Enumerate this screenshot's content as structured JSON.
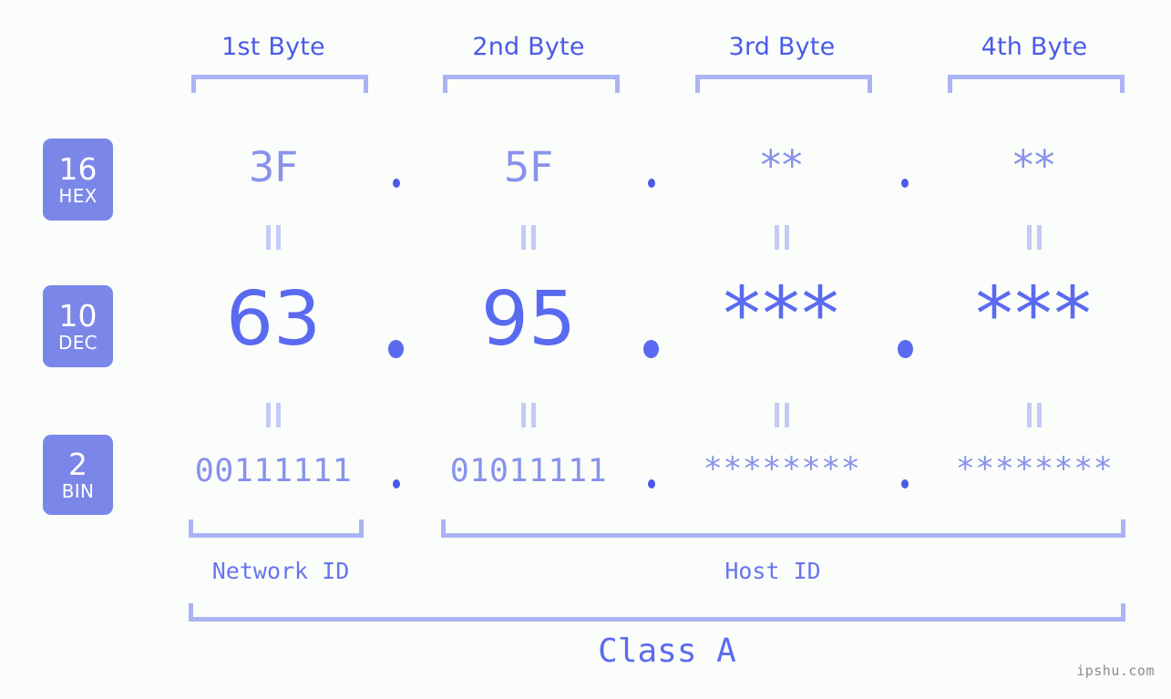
{
  "background_color": "#fbfdfa",
  "colors": {
    "badge_fill": "#7b87e8",
    "badge_text": "#ffffff",
    "bracket": "#aab4f5",
    "header_text": "#4a5ae8",
    "hex_text": "#8892ec",
    "dec_text": "#5a6af0",
    "bin_text": "#8892ec",
    "eq_mark": "#c3caf8",
    "watermark_text": "#8c8c8c"
  },
  "byte_headers": [
    {
      "label": "1st Byte"
    },
    {
      "label": "2nd Byte"
    },
    {
      "label": "3rd Byte"
    },
    {
      "label": "4th Byte"
    }
  ],
  "rows": [
    {
      "id": "hex",
      "badge_base": "16",
      "badge_name": "HEX",
      "values": [
        "3F",
        "5F",
        "**",
        "**"
      ],
      "separator": "."
    },
    {
      "id": "dec",
      "badge_base": "10",
      "badge_name": "DEC",
      "values": [
        "63",
        "95",
        "***",
        "***"
      ],
      "separator": "."
    },
    {
      "id": "bin",
      "badge_base": "2",
      "badge_name": "BIN",
      "values": [
        "00111111",
        "01011111",
        "********",
        "********"
      ],
      "separator": "."
    }
  ],
  "equivalence_mark": "||",
  "footer": {
    "network_id_label": "Network ID",
    "host_id_label": "Host ID",
    "class_label": "Class A"
  },
  "watermark": "ipshu.com"
}
